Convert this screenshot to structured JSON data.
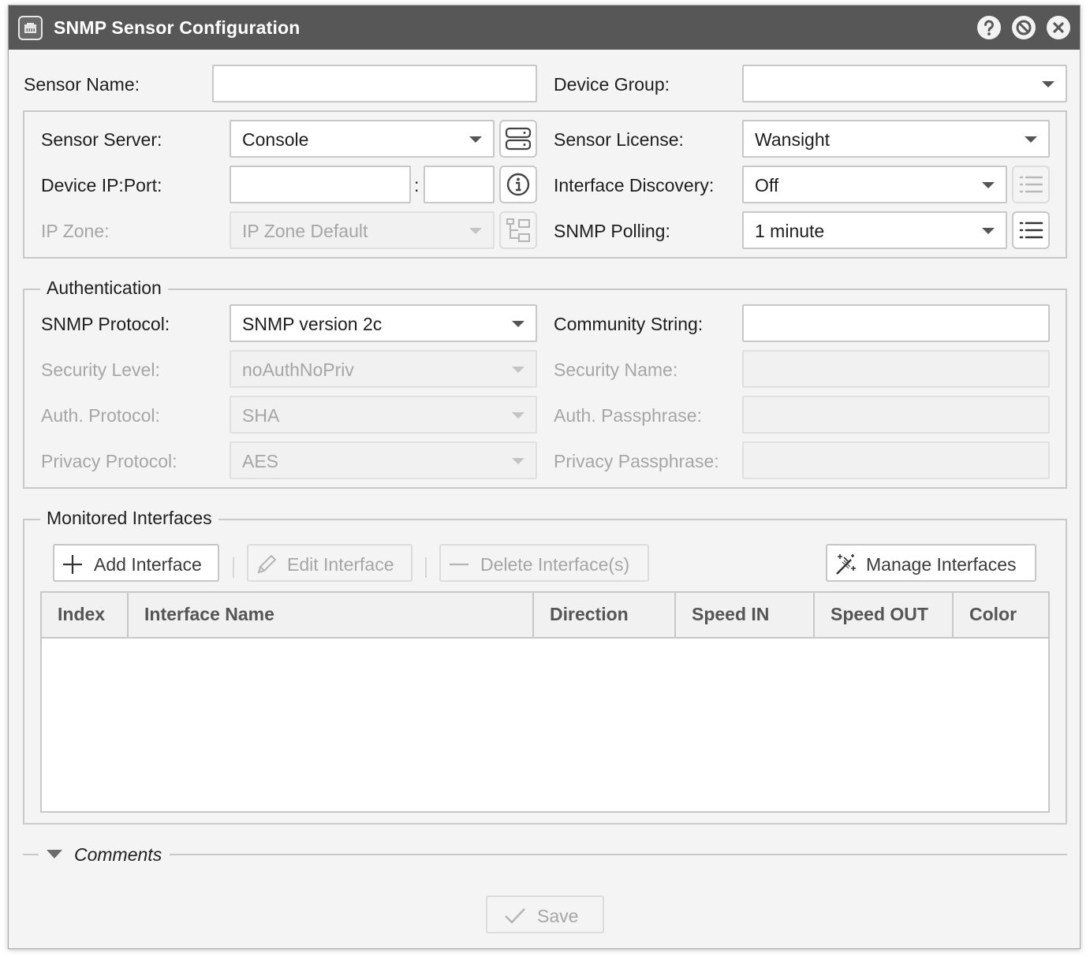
{
  "window": {
    "title": "SNMP Sensor Configuration",
    "title_icon": "network-jack-icon",
    "help_icon": "help-icon",
    "minimize_icon": "block-icon",
    "close_icon": "close-icon"
  },
  "general": {
    "sensor_name_label": "Sensor Name:",
    "sensor_name_value": "",
    "device_group_label": "Device Group:",
    "device_group_value": ""
  },
  "server": {
    "sensor_server_label": "Sensor Server:",
    "sensor_server_value": "Console",
    "device_ip_label": "Device IP:Port:",
    "device_ip_value": "",
    "port_separator": ":",
    "port_value": "",
    "ip_zone_label": "IP Zone:",
    "ip_zone_value": "IP Zone Default",
    "sensor_license_label": "Sensor License:",
    "sensor_license_value": "Wansight",
    "interface_discovery_label": "Interface Discovery:",
    "interface_discovery_value": "Off",
    "snmp_polling_label": "SNMP Polling:",
    "snmp_polling_value": "1 minute"
  },
  "authentication": {
    "legend": "Authentication",
    "snmp_protocol_label": "SNMP Protocol:",
    "snmp_protocol_value": "SNMP version 2c",
    "security_level_label": "Security Level:",
    "security_level_value": "noAuthNoPriv",
    "auth_protocol_label": "Auth. Protocol:",
    "auth_protocol_value": "SHA",
    "privacy_protocol_label": "Privacy Protocol:",
    "privacy_protocol_value": "AES",
    "community_string_label": "Community String:",
    "community_string_value": "",
    "security_name_label": "Security Name:",
    "security_name_value": "",
    "auth_passphrase_label": "Auth. Passphrase:",
    "auth_passphrase_value": "",
    "privacy_passphrase_label": "Privacy Passphrase:",
    "privacy_passphrase_value": ""
  },
  "interfaces": {
    "legend": "Monitored Interfaces",
    "add_label": "Add Interface",
    "edit_label": "Edit Interface",
    "delete_label": "Delete Interface(s)",
    "manage_label": "Manage Interfaces",
    "columns": [
      "Index",
      "Interface Name",
      "Direction",
      "Speed IN",
      "Speed OUT",
      "Color"
    ],
    "rows": []
  },
  "comments": {
    "label": "Comments"
  },
  "footer": {
    "save_label": "Save"
  }
}
